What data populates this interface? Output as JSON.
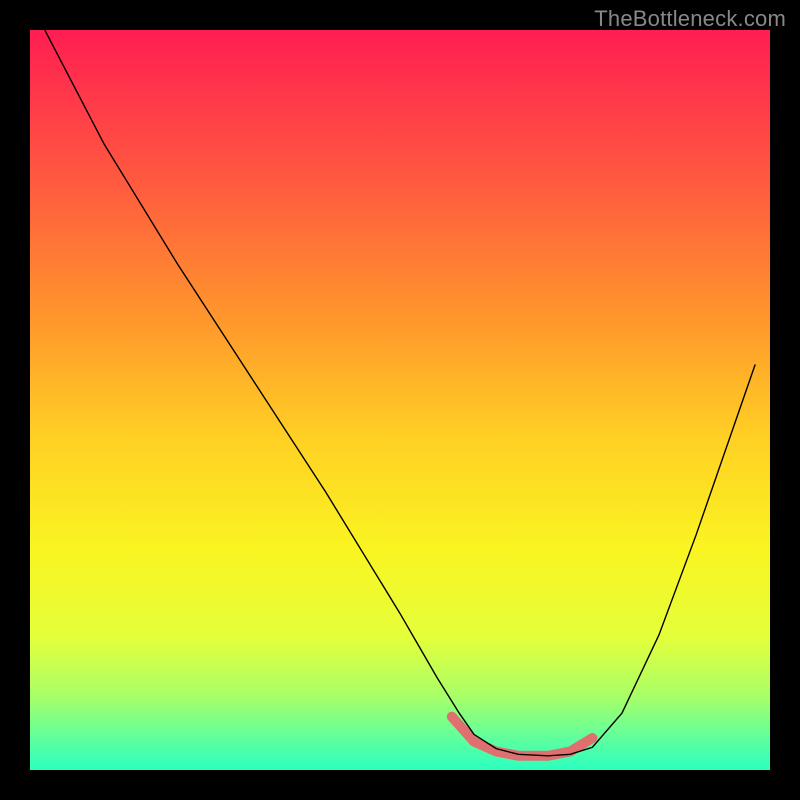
{
  "watermark": "TheBottleneck.com",
  "chart_data": {
    "type": "line",
    "title": "",
    "xlabel": "",
    "ylabel": "",
    "xlim": [
      0,
      100
    ],
    "ylim": [
      0,
      104
    ],
    "grid": false,
    "legend": false,
    "background_gradient": {
      "stops": [
        {
          "offset": 0.0,
          "color": "#ff1e52"
        },
        {
          "offset": 0.2,
          "color": "#ff5840"
        },
        {
          "offset": 0.4,
          "color": "#ff9a2b"
        },
        {
          "offset": 0.55,
          "color": "#ffd024"
        },
        {
          "offset": 0.7,
          "color": "#faf421"
        },
        {
          "offset": 0.82,
          "color": "#e4ff3a"
        },
        {
          "offset": 0.9,
          "color": "#a8ff68"
        },
        {
          "offset": 0.96,
          "color": "#5cff9f"
        },
        {
          "offset": 1.0,
          "color": "#2bffc0"
        }
      ]
    },
    "series": [
      {
        "name": "curve",
        "color": "#000000",
        "width": 1.4,
        "x": [
          2,
          10,
          20,
          30,
          40,
          50,
          55,
          58,
          60,
          63,
          66,
          70,
          73,
          76,
          80,
          85,
          90,
          98
        ],
        "y": [
          104,
          88,
          71,
          55,
          39,
          22,
          13,
          8,
          5,
          3,
          2.2,
          2,
          2.2,
          3.2,
          8,
          19,
          33,
          57
        ]
      },
      {
        "name": "flat-segment",
        "type": "fat-line",
        "color": "#e07070",
        "width": 10,
        "cap": "round",
        "x": [
          57,
          60,
          63,
          66,
          70,
          73,
          76
        ],
        "y": [
          7.5,
          4,
          2.6,
          2,
          2,
          2.6,
          4.5
        ]
      }
    ]
  }
}
